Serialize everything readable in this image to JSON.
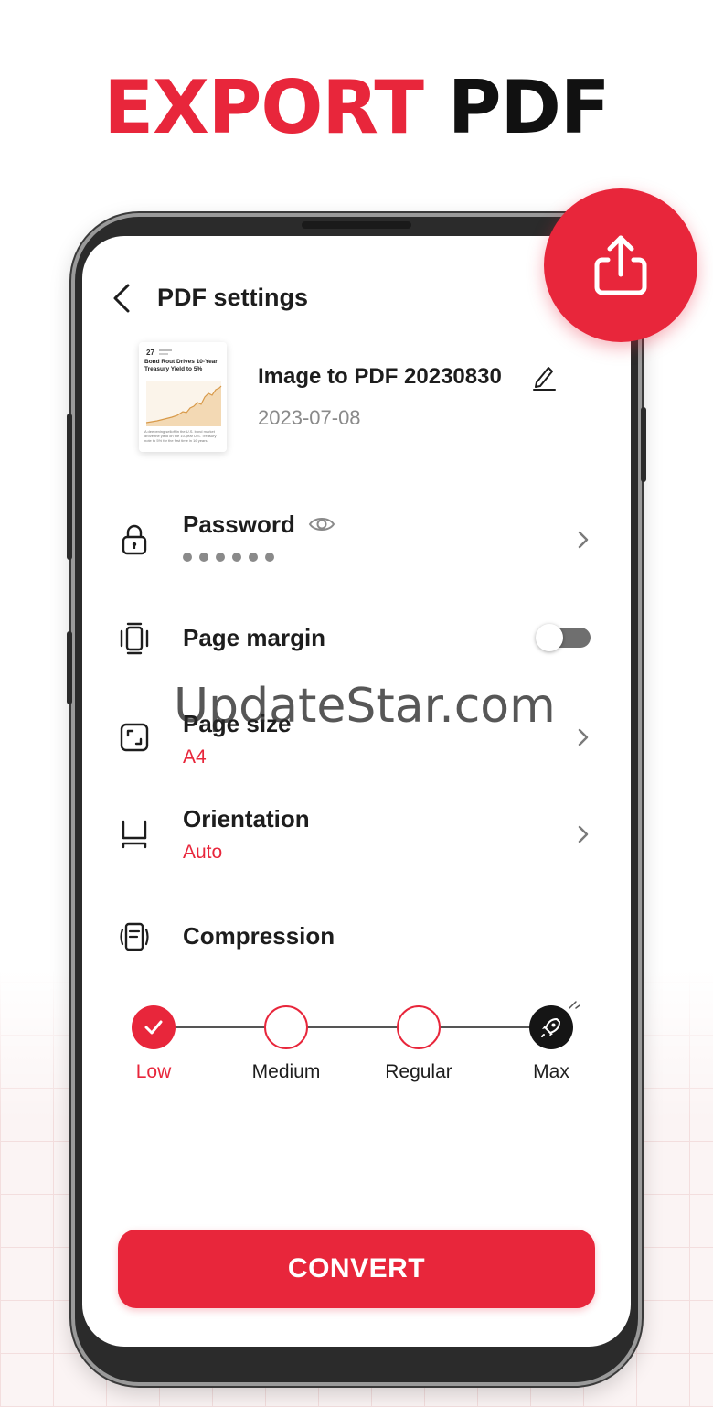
{
  "promo": {
    "headline_red": "EXPORT",
    "headline_black": "PDF"
  },
  "colors": {
    "accent": "#e8263b",
    "text_primary": "#1d1d1d",
    "text_secondary": "#8a8a8a"
  },
  "icons": {
    "fab": "share-icon",
    "back": "chevron-left-icon",
    "edit": "pencil-icon",
    "password": "lock-icon",
    "visibility": "eye-icon",
    "margin": "page-margin-icon",
    "size": "expand-icon",
    "orientation": "orientation-icon",
    "compression": "compress-icon",
    "max": "rocket-icon"
  },
  "screen": {
    "title": "PDF settings"
  },
  "document": {
    "name": "Image to PDF 20230830",
    "date": "2023-07-08",
    "thumbnail": {
      "day": "27",
      "headline": "Bond Rout Drives 10-Year Treasury Yield to 5%",
      "caption": "A deepening selloff in the U.S. bond market drove the yield on the 10-year U.S. Treasury note to 5% for the first time in 16 years."
    }
  },
  "settings": {
    "password": {
      "label": "Password",
      "masked_value": "••••••"
    },
    "page_margin": {
      "label": "Page margin",
      "enabled": false
    },
    "page_size": {
      "label": "Page size",
      "value": "A4"
    },
    "orientation": {
      "label": "Orientation",
      "value": "Auto"
    },
    "compression": {
      "label": "Compression",
      "levels": [
        "Low",
        "Medium",
        "Regular",
        "Max"
      ],
      "selected": "Low"
    }
  },
  "actions": {
    "convert_label": "CONVERT"
  },
  "watermark": "UpdateStar.com"
}
